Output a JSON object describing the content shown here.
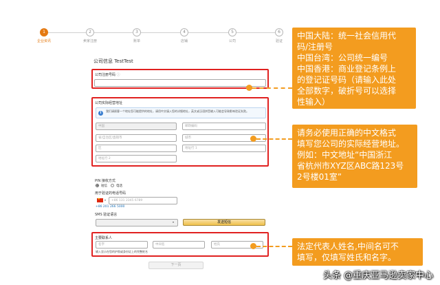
{
  "stepper": {
    "steps": [
      {
        "num": "1",
        "label": "企业资讯"
      },
      {
        "num": "2",
        "label": "卖家注册"
      },
      {
        "num": "3",
        "label": "账单"
      },
      {
        "num": "4",
        "label": "店铺"
      },
      {
        "num": "5",
        "label": "公司"
      },
      {
        "num": "6",
        "label": "验证"
      }
    ]
  },
  "form": {
    "title": "公司信息 TestTest",
    "reg_number_label": "公司注册号码",
    "address_section_label": "公司实际经营地址",
    "address_info": "我们请顾客一个地址您可能提供的地址，请用中文填入您的详细地址，英文或汉语拼音输入可能会导致影响验证失败。",
    "country_value": "中国",
    "postcode_placeholder": "邮政编码",
    "province_placeholder": "省/自治区/直辖市",
    "city_placeholder": "城市",
    "district_placeholder": "区",
    "address1_placeholder": "地址行 1",
    "address2_placeholder": "地址行 2",
    "pin_label": "PIN 接收方式",
    "pin_sms": "短信",
    "pin_call": "电话",
    "phone_label": "用于验证的电话号码",
    "phone_placeholder": "+86 131 2345 6789",
    "phone_example": "+86 201 266 5000",
    "sms_lang_label": "SMS 验证语言",
    "send_code_button": "发送短信",
    "contact_label": "主要联系人",
    "first_name_placeholder": "名字",
    "middle_name_placeholder": "中间名",
    "last_name_placeholder": "姓氏",
    "contact_note": "输入显示在您的护照或身份证上的完整姓名",
    "next_button": "下一页"
  },
  "callouts": {
    "reg_number": [
      "中国大陆：统一社会信用代",
      "码/注册号",
      "中国台湾：公司统一编号",
      "中国香港：商业登记条例上",
      "的登记证号码（请输入此处",
      "全部数字，破折号可以选择",
      "性输入）"
    ],
    "address": [
      "请务必使用正确的中文格式",
      "填写您公司的实际经营地址。",
      "例如：中文地址“中国浙江",
      "省杭州市XYZ区ABC路123号",
      "2号楼01室”"
    ],
    "name": [
      "法定代表人姓名,中间名可不",
      "填写，仅填写姓氏和名字。"
    ]
  },
  "watermark": "头条 @重庆亚马逊卖家中心",
  "colors": {
    "accent_orange": "#f39c1f",
    "highlight_red": "#e0201f",
    "step_active": "#e47911"
  }
}
